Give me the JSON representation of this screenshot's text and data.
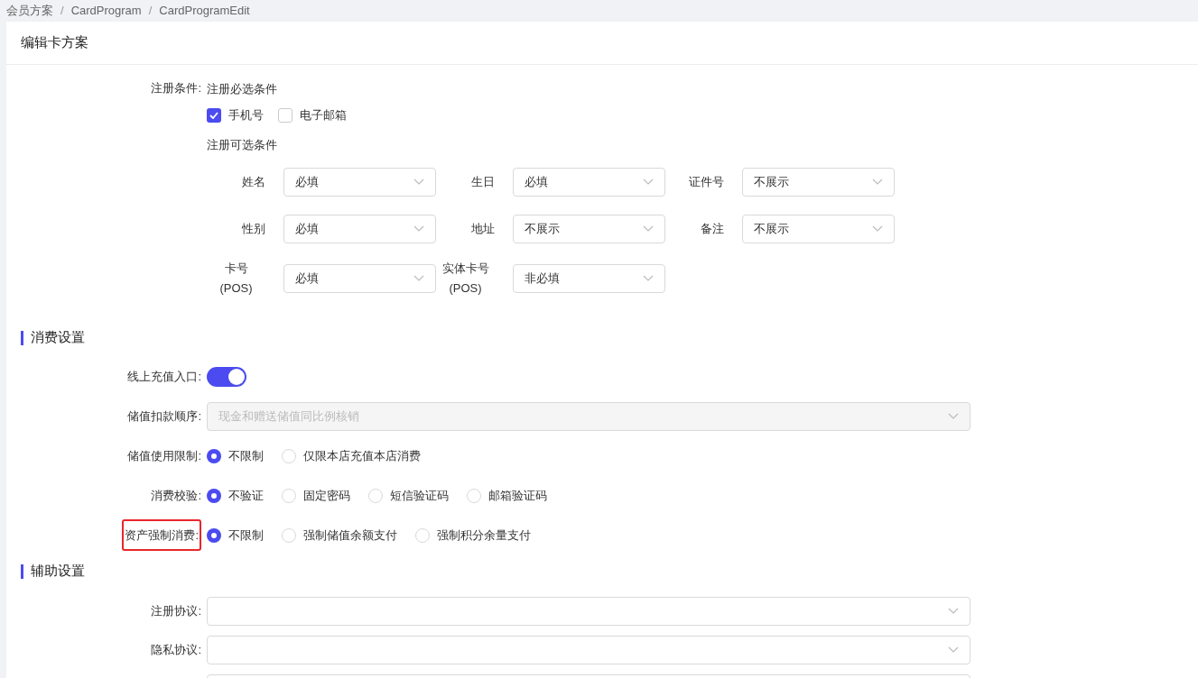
{
  "breadcrumb": [
    {
      "kind": "link",
      "text": "会员方案"
    },
    {
      "kind": "separator",
      "text": "/"
    },
    {
      "kind": "link",
      "text": "CardProgram"
    },
    {
      "kind": "separator",
      "text": "/"
    },
    {
      "kind": "link",
      "text": "CardProgramEdit"
    }
  ],
  "page_title": "编辑卡方案",
  "registration": {
    "label": "注册条件:",
    "required_title": "注册必选条件",
    "required_options": [
      {
        "label": "手机号",
        "checked": true
      },
      {
        "label": "电子邮箱",
        "checked": false
      }
    ],
    "optional_title": "注册可选条件",
    "optional_fields": [
      {
        "label": "姓名",
        "value": "必填"
      },
      {
        "label": "生日",
        "value": "必填"
      },
      {
        "label": "证件号",
        "value": "不展示"
      },
      {
        "label": "性别",
        "value": "必填"
      },
      {
        "label": "地址",
        "value": "不展示"
      },
      {
        "label": "备注",
        "value": "不展示"
      },
      {
        "label": "卡号\n(POS)",
        "value": "必填"
      },
      {
        "label": "实体卡号\n(POS)",
        "value": "非必填"
      }
    ]
  },
  "sections": [
    {
      "title": "消费设置",
      "rows": [
        {
          "kind": "toggle",
          "label": "线上充值入口:",
          "on": true
        },
        {
          "kind": "select",
          "label": "储值扣款顺序:",
          "value": "现金和赠送储值同比例核销",
          "disabled": true
        },
        {
          "kind": "radio",
          "label": "储值使用限制:",
          "options": [
            {
              "label": "不限制",
              "selected": true
            },
            {
              "label": "仅限本店充值本店消费",
              "selected": false
            }
          ]
        },
        {
          "kind": "radio",
          "label": "消费校验:",
          "options": [
            {
              "label": "不验证",
              "selected": true
            },
            {
              "label": "固定密码",
              "selected": false
            },
            {
              "label": "短信验证码",
              "selected": false
            },
            {
              "label": "邮箱验证码",
              "selected": false
            }
          ]
        },
        {
          "kind": "radio",
          "label": "资产强制消费:",
          "highlighted": true,
          "options": [
            {
              "label": "不限制",
              "selected": true
            },
            {
              "label": "强制储值余额支付",
              "selected": false
            },
            {
              "label": "强制积分余量支付",
              "selected": false
            }
          ]
        }
      ]
    },
    {
      "title": "辅助设置",
      "rows": [
        {
          "kind": "select",
          "label": "注册协议:"
        },
        {
          "kind": "select",
          "label": "隐私协议:"
        },
        {
          "kind": "select"
        }
      ]
    }
  ]
}
